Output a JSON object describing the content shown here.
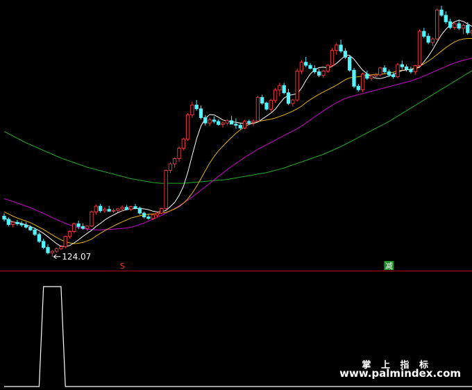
{
  "chart_data": {
    "type": "candlestick",
    "low_label": "124.07",
    "signals": [
      {
        "label": "S",
        "candle": 27,
        "color": "#ff3030",
        "bg": "#000000"
      },
      {
        "label": "减",
        "candle": 88,
        "color": "#ffffff",
        "bg": "#1f8f2a"
      }
    ],
    "colors": {
      "up": "#ff3b3b",
      "down": "#54f4ff",
      "ma_white": "#ffffff",
      "ma_yellow": "#e6b400",
      "ma_magenta": "#d000d0",
      "ma_green": "#22b022",
      "divider": "#b00000",
      "indicator": "#ffffff"
    },
    "candles": [
      [
        127.8,
        128.5,
        126.4,
        127.0
      ],
      [
        127.0,
        127.5,
        125.1,
        125.6
      ],
      [
        125.6,
        126.4,
        124.9,
        126.2
      ],
      [
        126.2,
        126.8,
        125.3,
        125.8
      ],
      [
        125.8,
        126.5,
        125.0,
        125.5
      ],
      [
        125.5,
        126.2,
        124.6,
        124.9
      ],
      [
        124.9,
        125.4,
        123.9,
        124.2
      ],
      [
        124.2,
        124.8,
        122.6,
        123.0
      ],
      [
        123.0,
        123.5,
        120.8,
        121.2
      ],
      [
        121.2,
        121.9,
        119.1,
        119.6
      ],
      [
        119.6,
        120.4,
        117.8,
        118.2
      ],
      [
        118.2,
        118.9,
        117.2,
        118.6
      ],
      [
        118.6,
        119.5,
        118.2,
        119.3
      ],
      [
        119.3,
        120.2,
        118.9,
        119.8
      ],
      [
        119.8,
        122.7,
        119.4,
        122.5
      ],
      [
        122.5,
        124.1,
        121.9,
        123.8
      ],
      [
        123.8,
        126.1,
        123.3,
        125.8
      ],
      [
        125.8,
        126.6,
        124.4,
        125.1
      ],
      [
        125.1,
        125.9,
        124.2,
        124.6
      ],
      [
        124.6,
        125.4,
        123.9,
        125.2
      ],
      [
        125.2,
        129.3,
        124.9,
        128.9
      ],
      [
        128.9,
        130.8,
        128.2,
        130.4
      ],
      [
        130.4,
        131.0,
        128.7,
        129.2
      ],
      [
        129.2,
        130.1,
        128.6,
        129.6
      ],
      [
        129.6,
        130.5,
        128.9,
        129.1
      ],
      [
        129.1,
        129.8,
        128.6,
        129.3
      ],
      [
        129.3,
        130.0,
        128.8,
        129.7
      ],
      [
        129.7,
        130.6,
        129.0,
        130.1
      ],
      [
        130.1,
        130.7,
        129.3,
        129.6
      ],
      [
        129.6,
        130.5,
        129.1,
        130.3
      ],
      [
        130.3,
        131.0,
        129.6,
        129.9
      ],
      [
        129.9,
        130.3,
        128.2,
        128.6
      ],
      [
        128.6,
        129.0,
        127.2,
        127.6
      ],
      [
        127.6,
        128.3,
        126.9,
        127.2
      ],
      [
        127.2,
        128.4,
        126.8,
        128.1
      ],
      [
        128.1,
        128.9,
        127.5,
        128.6
      ],
      [
        128.6,
        130.0,
        128.3,
        129.8
      ],
      [
        129.8,
        140.0,
        129.5,
        139.8
      ],
      [
        139.8,
        141.9,
        139.1,
        141.5
      ],
      [
        141.5,
        143.2,
        140.5,
        142.9
      ],
      [
        142.9,
        146.0,
        142.0,
        145.6
      ],
      [
        145.6,
        148.3,
        145.0,
        148.0
      ],
      [
        148.0,
        154.8,
        147.5,
        154.3
      ],
      [
        154.3,
        157.8,
        153.6,
        156.9
      ],
      [
        156.9,
        158.2,
        155.4,
        155.9
      ],
      [
        155.9,
        156.8,
        153.1,
        153.6
      ],
      [
        153.6,
        154.3,
        151.5,
        152.2
      ],
      [
        152.2,
        153.6,
        151.4,
        153.0
      ],
      [
        153.0,
        153.9,
        152.1,
        152.6
      ],
      [
        152.6,
        153.1,
        151.5,
        151.8
      ],
      [
        151.8,
        152.6,
        151.0,
        152.2
      ],
      [
        152.2,
        153.2,
        151.6,
        152.8
      ],
      [
        152.8,
        154.0,
        152.1,
        151.9
      ],
      [
        151.9,
        153.4,
        150.7,
        151.6
      ],
      [
        151.6,
        152.1,
        150.5,
        150.9
      ],
      [
        150.9,
        153.0,
        150.6,
        152.6
      ],
      [
        152.6,
        153.1,
        151.7,
        152.3
      ],
      [
        152.3,
        153.2,
        151.4,
        152.7
      ],
      [
        152.7,
        159.3,
        152.3,
        158.9
      ],
      [
        158.9,
        159.6,
        157.0,
        157.4
      ],
      [
        157.4,
        157.8,
        155.4,
        155.8
      ],
      [
        155.8,
        158.4,
        155.1,
        158.1
      ],
      [
        158.1,
        161.3,
        157.5,
        160.8
      ],
      [
        160.8,
        162.7,
        159.2,
        162.0
      ],
      [
        162.0,
        162.7,
        159.7,
        160.1
      ],
      [
        160.1,
        161.1,
        156.9,
        157.3
      ],
      [
        157.3,
        158.5,
        156.5,
        158.2
      ],
      [
        158.2,
        166.4,
        157.8,
        165.8
      ],
      [
        165.8,
        168.6,
        165.0,
        168.1
      ],
      [
        168.1,
        169.5,
        166.8,
        167.3
      ],
      [
        167.3,
        167.9,
        166.2,
        166.5
      ],
      [
        166.5,
        167.3,
        165.1,
        165.6
      ],
      [
        165.6,
        166.3,
        164.2,
        164.7
      ],
      [
        164.7,
        166.1,
        164.0,
        165.8
      ],
      [
        165.8,
        167.6,
        165.3,
        167.3
      ],
      [
        167.3,
        171.8,
        166.9,
        171.2
      ],
      [
        171.2,
        173.1,
        170.1,
        172.6
      ],
      [
        172.6,
        174.0,
        170.5,
        171.0
      ],
      [
        171.0,
        171.8,
        168.9,
        169.4
      ],
      [
        169.4,
        169.9,
        165.6,
        166.0
      ],
      [
        166.0,
        166.6,
        161.3,
        161.8
      ],
      [
        161.8,
        162.4,
        160.4,
        160.9
      ],
      [
        160.9,
        165.4,
        160.3,
        165.0
      ],
      [
        165.0,
        165.9,
        163.5,
        163.9
      ],
      [
        163.9,
        164.9,
        163.3,
        164.5
      ],
      [
        164.5,
        165.3,
        163.9,
        164.8
      ],
      [
        164.8,
        166.9,
        164.4,
        166.6
      ],
      [
        166.6,
        167.3,
        165.1,
        165.6
      ],
      [
        165.6,
        166.2,
        164.3,
        164.8
      ],
      [
        164.8,
        165.5,
        163.8,
        164.3
      ],
      [
        164.3,
        167.9,
        163.9,
        167.5
      ],
      [
        167.5,
        168.5,
        166.2,
        166.9
      ],
      [
        166.9,
        167.5,
        165.7,
        166.2
      ],
      [
        166.2,
        166.9,
        165.1,
        165.6
      ],
      [
        165.6,
        167.4,
        164.8,
        167.2
      ],
      [
        167.2,
        176.7,
        166.9,
        176.2
      ],
      [
        176.2,
        177.1,
        174.5,
        174.9
      ],
      [
        174.9,
        175.7,
        172.8,
        173.3
      ],
      [
        173.3,
        174.6,
        172.3,
        174.2
      ],
      [
        174.2,
        182.2,
        173.8,
        181.8
      ],
      [
        181.8,
        182.9,
        180.0,
        180.4
      ],
      [
        180.4,
        181.4,
        178.2,
        178.7
      ],
      [
        178.7,
        179.5,
        176.7,
        177.2
      ],
      [
        177.2,
        178.6,
        176.6,
        178.2
      ],
      [
        178.2,
        179.3,
        176.5,
        177.0
      ],
      [
        177.0,
        178.2,
        175.5,
        177.8
      ],
      [
        177.8,
        178.6,
        175.3,
        175.8
      ],
      [
        175.8,
        176.7,
        175.0,
        176.3
      ]
    ],
    "ma_white": [
      127.4,
      126.7,
      126.3,
      126.1,
      125.9,
      125.5,
      125.1,
      124.6,
      124.0,
      123.3,
      122.4,
      121.5,
      120.6,
      119.9,
      119.8,
      120.1,
      120.8,
      121.6,
      122.5,
      123.3,
      124.1,
      125.1,
      125.9,
      126.8,
      127.5,
      128.1,
      128.7,
      129.2,
      129.5,
      129.7,
      129.8,
      129.8,
      129.7,
      129.5,
      129.1,
      128.9,
      128.9,
      129.3,
      130.3,
      131.4,
      133.2,
      135.6,
      139.3,
      143.7,
      148.0,
      151.4,
      153.4,
      154.4,
      154.3,
      153.7,
      153.0,
      152.7,
      152.5,
      152.4,
      152.2,
      152.0,
      152.0,
      152.1,
      152.4,
      153.2,
      154.0,
      154.8,
      155.8,
      157.3,
      158.7,
      159.4,
      159.6,
      159.9,
      161.3,
      163.3,
      165.0,
      166.1,
      166.7,
      166.8,
      166.6,
      167.0,
      167.8,
      168.8,
      169.9,
      169.9,
      168.9,
      167.4,
      166.0,
      165.1,
      164.3,
      163.9,
      163.8,
      164.1,
      164.5,
      164.9,
      165.5,
      165.9,
      166.1,
      166.2,
      166.4,
      166.8,
      168.2,
      169.7,
      171.4,
      173.4,
      175.3,
      176.7,
      177.9,
      178.7,
      179.1,
      178.8,
      178.1,
      177.5
    ],
    "ma_yellow": [
      128.9,
      128.4,
      127.8,
      127.3,
      126.9,
      126.5,
      126.1,
      125.5,
      124.9,
      124.3,
      123.6,
      122.9,
      122.2,
      121.6,
      121.1,
      120.8,
      120.6,
      120.7,
      120.9,
      121.3,
      121.8,
      122.6,
      123.3,
      124.0,
      124.6,
      125.2,
      125.8,
      126.3,
      126.8,
      127.3,
      127.6,
      127.9,
      128.1,
      128.3,
      128.4,
      128.5,
      128.6,
      128.8,
      129.2,
      129.7,
      130.3,
      131.2,
      132.3,
      133.8,
      135.6,
      137.6,
      139.7,
      141.7,
      143.4,
      144.9,
      146.1,
      147.3,
      148.4,
      149.5,
      150.4,
      151.2,
      151.8,
      152.2,
      152.5,
      152.8,
      153.0,
      153.2,
      153.5,
      153.9,
      154.3,
      154.8,
      155.3,
      155.9,
      156.6,
      157.5,
      158.3,
      159.0,
      159.7,
      160.3,
      160.9,
      161.5,
      162.1,
      162.8,
      163.5,
      164.0,
      164.2,
      164.3,
      164.5,
      164.7,
      164.8,
      164.9,
      165.0,
      165.1,
      165.3,
      165.5,
      165.8,
      166.0,
      166.1,
      166.3,
      166.6,
      167.0,
      167.7,
      168.4,
      169.2,
      170.1,
      171.0,
      171.9,
      172.7,
      173.4,
      173.9,
      174.2,
      174.3,
      174.3
    ],
    "ma_magenta": [
      132.4,
      132.0,
      131.6,
      131.2,
      130.8,
      130.4,
      130.0,
      129.5,
      129.0,
      128.5,
      128.0,
      127.4,
      126.9,
      126.4,
      125.9,
      125.5,
      125.1,
      124.8,
      124.6,
      124.4,
      124.3,
      124.2,
      124.2,
      124.3,
      124.3,
      124.4,
      124.5,
      124.6,
      124.7,
      124.9,
      125.2,
      125.6,
      126.0,
      126.5,
      127.0,
      127.5,
      128.0,
      128.6,
      129.2,
      129.8,
      130.5,
      131.2,
      132.0,
      132.8,
      133.7,
      134.6,
      135.5,
      136.4,
      137.3,
      138.2,
      139.1,
      140.0,
      140.8,
      141.6,
      142.4,
      143.2,
      143.9,
      144.6,
      145.3,
      145.9,
      146.5,
      147.1,
      147.7,
      148.3,
      148.9,
      149.5,
      150.1,
      150.7,
      151.4,
      152.2,
      153.0,
      153.8,
      154.6,
      155.4,
      156.1,
      156.8,
      157.5,
      158.1,
      158.6,
      159.0,
      159.3,
      159.6,
      159.9,
      160.2,
      160.5,
      160.8,
      161.1,
      161.4,
      161.7,
      162.0,
      162.3,
      162.6,
      162.9,
      163.2,
      163.6,
      164.0,
      164.5,
      165.0,
      165.5,
      166.0,
      166.5,
      167.0,
      167.5,
      167.9,
      168.3,
      168.6,
      168.9,
      169.2
    ],
    "ma_green": [
      150.0,
      149.4,
      148.8,
      148.2,
      147.6,
      147.0,
      146.5,
      146.0,
      145.5,
      145.0,
      144.5,
      144.0,
      143.5,
      143.0,
      142.6,
      142.2,
      141.8,
      141.4,
      141.0,
      140.6,
      140.3,
      140.0,
      139.7,
      139.4,
      139.1,
      138.8,
      138.5,
      138.2,
      137.9,
      137.6,
      137.4,
      137.2,
      137.0,
      136.8,
      136.6,
      136.5,
      136.4,
      136.4,
      136.4,
      136.4,
      136.4,
      136.4,
      136.5,
      136.6,
      136.7,
      136.8,
      136.9,
      137.0,
      137.1,
      137.2,
      137.3,
      137.4,
      137.6,
      137.8,
      138.0,
      138.2,
      138.4,
      138.6,
      138.8,
      139.0,
      139.2,
      139.5,
      139.8,
      140.1,
      140.4,
      140.8,
      141.2,
      141.6,
      142.0,
      142.4,
      142.8,
      143.2,
      143.6,
      144.0,
      144.5,
      145.0,
      145.5,
      146.0,
      146.6,
      147.2,
      147.8,
      148.4,
      149.0,
      149.6,
      150.2,
      150.8,
      151.4,
      152.0,
      152.6,
      153.3,
      154.0,
      154.7,
      155.4,
      156.1,
      156.8,
      157.5,
      158.2,
      158.9,
      159.6,
      160.3,
      161.0,
      161.7,
      162.4,
      163.1,
      163.8,
      164.5,
      165.2,
      165.9
    ],
    "indicator": [
      0,
      0,
      0,
      0,
      0,
      0,
      0,
      0,
      0,
      1,
      1,
      1,
      1,
      1,
      0,
      0,
      0,
      0,
      0,
      0,
      0,
      0,
      0,
      0,
      0,
      0,
      0,
      0,
      0,
      0,
      0,
      0,
      0,
      0,
      0,
      0,
      0,
      0,
      0,
      0,
      0,
      0,
      0,
      0,
      0,
      0,
      0,
      0,
      0,
      0,
      0,
      0,
      0,
      0,
      0,
      0,
      0,
      0,
      0,
      0,
      0,
      0,
      0,
      0,
      0,
      0,
      0,
      0,
      0,
      0,
      0,
      0,
      0,
      0,
      0,
      0,
      0,
      0,
      0,
      0,
      0,
      0,
      0,
      0,
      0,
      0,
      0,
      0,
      0,
      0,
      0,
      0,
      0,
      0,
      0,
      0,
      0,
      0,
      0,
      0,
      0,
      0,
      0,
      0,
      0,
      0,
      0,
      0
    ]
  },
  "watermark": {
    "title": "掌 上 指 标",
    "url": "www.palmindex.com"
  }
}
